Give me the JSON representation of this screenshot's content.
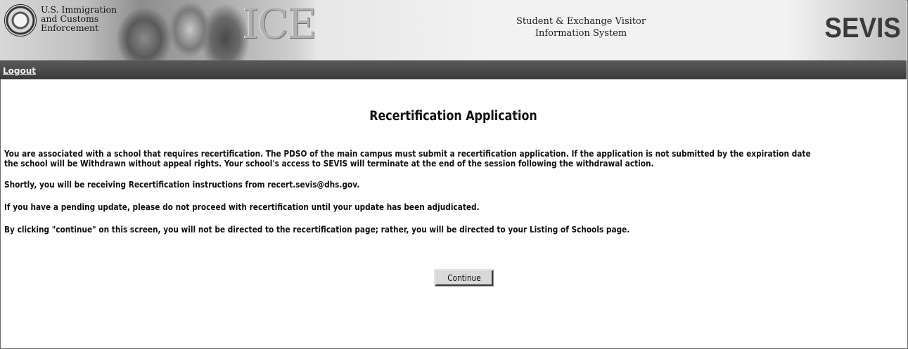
{
  "header": {
    "agency_lines": [
      "U.S. Immigration",
      "and Customs",
      "Enforcement"
    ],
    "ice_logo": "ICE",
    "system_name_lines": [
      "Student & Exchange Visitor",
      "Information System"
    ],
    "sevis_logo": "SEVIS"
  },
  "nav": {
    "logout_label": "Logout"
  },
  "main": {
    "title": "Recertification Application",
    "paragraph1_line1": "You are associated with a school that requires recertification. The PDSO of the main campus must submit a recertification application. If the application is not submitted by the expiration date",
    "paragraph1_line2": "the school will be Withdrawn without appeal rights. Your school's access to SEVIS will terminate at the end of the session following the withdrawal action.",
    "paragraph2": "Shortly, you will be receiving Recertification instructions from recert.sevis@dhs.gov.",
    "paragraph3": "If you have a pending update, please do not proceed with recertification until your update has been adjudicated.",
    "paragraph4": "By clicking \"continue\" on this screen, you will not be directed to the recertification page; rather, you will be directed to your Listing of Schools page.",
    "continue_label": "Continue"
  },
  "icons": {
    "seal": "dhs-seal-icon"
  },
  "colors": {
    "navbar": "#4a4a4a",
    "text": "#111111",
    "button_face": "#d9d9d9"
  }
}
